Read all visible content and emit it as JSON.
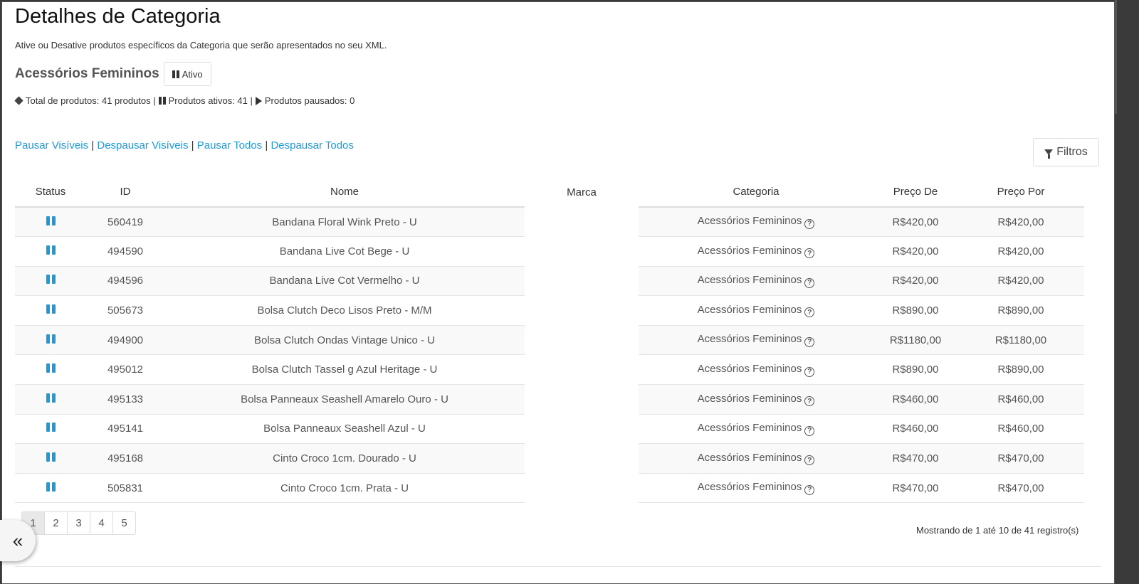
{
  "page": {
    "title": "Detalhes de Categoria",
    "subtitle": "Ative ou Desative produtos específicos da Categoria que serão apresentados no seu XML."
  },
  "category": {
    "name": "Acessórios Femininos",
    "status_label": "Ativo"
  },
  "stats": {
    "total": "Total de produtos: 41 produtos |",
    "active": "Produtos ativos: 41 |",
    "paused": "Produtos pausados: 0"
  },
  "actions": {
    "pause_visible": "Pausar Visíveis",
    "unpause_visible": "Despausar Visíveis",
    "pause_all": "Pausar Todos",
    "unpause_all": "Despausar Todos",
    "separator": "|"
  },
  "filter_button": "Filtros",
  "table": {
    "headers": {
      "status": "Status",
      "id": "ID",
      "nome": "Nome",
      "marca": "Marca",
      "categoria": "Categoria",
      "preco_de": "Preço De",
      "preco_por": "Preço Por"
    },
    "rows": [
      {
        "id": "560419",
        "nome": "Bandana Floral Wink Preto - U",
        "marca": "",
        "categoria": "Acessórios Femininos",
        "preco_de": "R$420,00",
        "preco_por": "R$420,00"
      },
      {
        "id": "494590",
        "nome": "Bandana Live Cot Bege - U",
        "marca": "",
        "categoria": "Acessórios Femininos",
        "preco_de": "R$420,00",
        "preco_por": "R$420,00"
      },
      {
        "id": "494596",
        "nome": "Bandana Live Cot Vermelho - U",
        "marca": "",
        "categoria": "Acessórios Femininos",
        "preco_de": "R$420,00",
        "preco_por": "R$420,00"
      },
      {
        "id": "505673",
        "nome": "Bolsa Clutch Deco Lisos Preto - M/M",
        "marca": "",
        "categoria": "Acessórios Femininos",
        "preco_de": "R$890,00",
        "preco_por": "R$890,00"
      },
      {
        "id": "494900",
        "nome": "Bolsa Clutch Ondas Vintage Unico - U",
        "marca": "",
        "categoria": "Acessórios Femininos",
        "preco_de": "R$1180,00",
        "preco_por": "R$1180,00"
      },
      {
        "id": "495012",
        "nome": "Bolsa Clutch Tassel g Azul Heritage - U",
        "marca": "",
        "categoria": "Acessórios Femininos",
        "preco_de": "R$890,00",
        "preco_por": "R$890,00"
      },
      {
        "id": "495133",
        "nome": "Bolsa Panneaux Seashell Amarelo Ouro - U",
        "marca": "",
        "categoria": "Acessórios Femininos",
        "preco_de": "R$460,00",
        "preco_por": "R$460,00"
      },
      {
        "id": "495141",
        "nome": "Bolsa Panneaux Seashell Azul - U",
        "marca": "",
        "categoria": "Acessórios Femininos",
        "preco_de": "R$460,00",
        "preco_por": "R$460,00"
      },
      {
        "id": "495168",
        "nome": "Cinto Croco 1cm. Dourado - U",
        "marca": "",
        "categoria": "Acessórios Femininos",
        "preco_de": "R$470,00",
        "preco_por": "R$470,00"
      },
      {
        "id": "505831",
        "nome": "Cinto Croco 1cm. Prata - U",
        "marca": "",
        "categoria": "Acessórios Femininos",
        "preco_de": "R$470,00",
        "preco_por": "R$470,00"
      }
    ]
  },
  "pagination": {
    "pages": [
      "1",
      "2",
      "3",
      "4",
      "5"
    ],
    "current": "1"
  },
  "showing": "Mostrando de 1 até 10 de 41 registro(s)",
  "colors": {
    "link": "#1e9bd7",
    "pause_icon": "#1e9bd7"
  },
  "icons": {
    "collapse": "«"
  }
}
